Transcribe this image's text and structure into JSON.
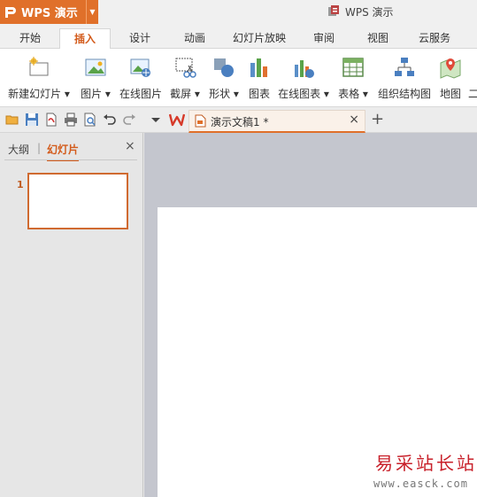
{
  "app": {
    "brand_label": "WPS 演示",
    "window_title": "WPS 演示",
    "brand_color": "#e0702a"
  },
  "tabs": [
    {
      "label": "开始"
    },
    {
      "label": "插入",
      "active": true
    },
    {
      "label": "设计"
    },
    {
      "label": "动画"
    },
    {
      "label": "幻灯片放映"
    },
    {
      "label": "审阅"
    },
    {
      "label": "视图"
    },
    {
      "label": "云服务"
    }
  ],
  "ribbon": {
    "new_slide": "新建幻灯片",
    "picture": "图片",
    "online_picture": "在线图片",
    "screenshot": "截屏",
    "shapes": "形状",
    "chart": "图表",
    "online_chart": "在线图表",
    "table": "表格",
    "org_chart": "组织结构图",
    "map": "地图",
    "overflow": "二"
  },
  "doc_tab": {
    "name": "演示文稿1 *",
    "close": "×"
  },
  "left_panel": {
    "outline_tab": "大纲",
    "separator": "|",
    "slides_tab": "幻灯片",
    "close": "×",
    "slide_number": "1"
  },
  "watermark": {
    "cn": "易采站长站",
    "url": "www.easck.com"
  }
}
